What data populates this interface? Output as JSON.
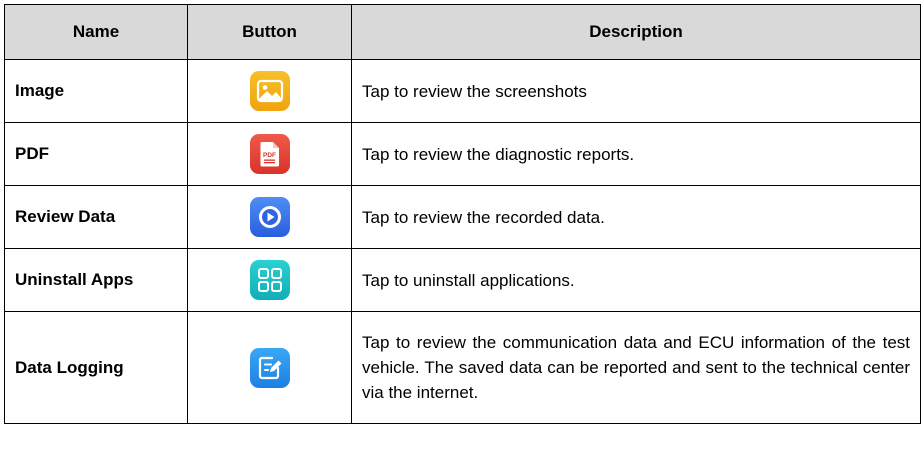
{
  "table": {
    "headers": {
      "name": "Name",
      "button": "Button",
      "description": "Description"
    },
    "rows": [
      {
        "name": "Image",
        "icon": "image-icon",
        "description": "Tap to review the screenshots"
      },
      {
        "name": "PDF",
        "icon": "pdf-icon",
        "description": "Tap to review the diagnostic reports."
      },
      {
        "name": "Review Data",
        "icon": "play-icon",
        "description": "Tap to review the recorded data."
      },
      {
        "name": "Uninstall Apps",
        "icon": "apps-grid-icon",
        "description": "Tap to uninstall applications."
      },
      {
        "name": "Data Logging",
        "icon": "edit-note-icon",
        "description": "Tap to review the communication data and ECU information of the test vehicle. The saved data can be reported and sent to the technical center via the internet."
      }
    ]
  },
  "colors": {
    "header_bg": "#d9d9d9",
    "image_icon": "#f4b41e",
    "pdf_icon": "#e2443a",
    "review_icon": "#3b74e8",
    "apps_icon": "#1cbcc4",
    "log_icon": "#2b92ec"
  }
}
